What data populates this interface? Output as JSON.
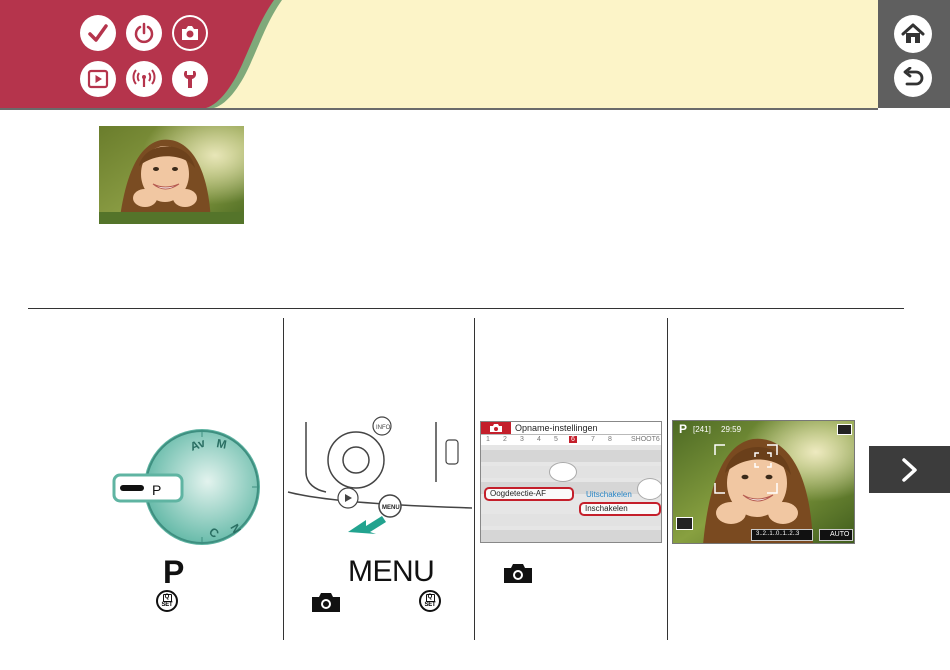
{
  "header": {
    "tabs": [
      {
        "name": "check-icon"
      },
      {
        "name": "power-icon"
      },
      {
        "name": "camera-icon",
        "active": true
      },
      {
        "name": "play-icon"
      },
      {
        "name": "wireless-icon"
      },
      {
        "name": "wrench-icon"
      }
    ],
    "home_icon": "home-icon",
    "back_icon": "back-arrow-icon",
    "colors": {
      "red": "#b5344c",
      "cream": "#fcf4c8",
      "dark": "#5f5f5f"
    }
  },
  "steps": {
    "step1": {
      "mode_label": "P",
      "dial_letters": [
        "P",
        "Av",
        "Tv",
        "M",
        "C"
      ]
    },
    "step2": {
      "menu_label": "MENU"
    },
    "step3": {
      "screen_title": "Opname-instellingen",
      "tab_numbers": [
        "1",
        "2",
        "3",
        "4",
        "5",
        "6",
        "7",
        "8"
      ],
      "tab_name": "SHOOT6",
      "selected_tab": "6",
      "item_label": "Oogdetectie-AF",
      "value_off": "Uitschakelen",
      "value_on": "Inschakelen"
    },
    "step4": {
      "mode": "P",
      "shots": "[241]",
      "time": "29:59",
      "scale": "3..2..1..0..1..2..3",
      "auto_label": "AUTO"
    }
  },
  "next_icon": "chevron-right-icon"
}
